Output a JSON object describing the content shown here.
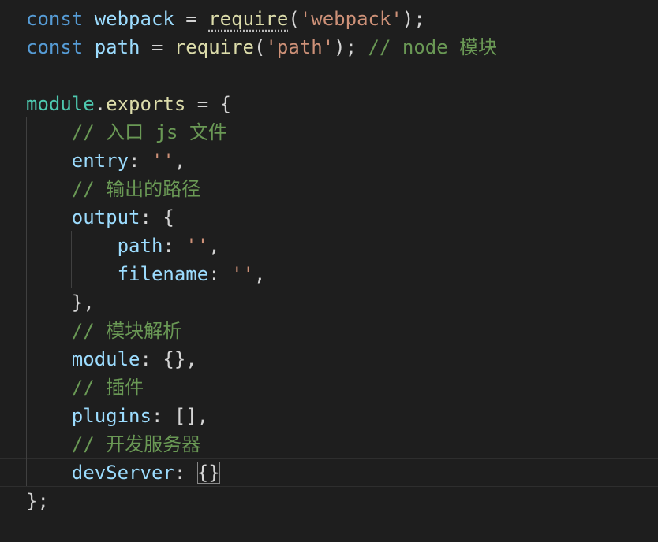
{
  "editor": {
    "colors": {
      "background": "#1e1e1e",
      "keyword": "#569cd6",
      "variable": "#9cdcfe",
      "function": "#dcdcaa",
      "string": "#ce9178",
      "comment": "#6a9955",
      "punctuation": "#d4d4d4"
    },
    "lines": [
      {
        "tokens": [
          [
            "kw",
            "const"
          ],
          [
            "pun",
            " "
          ],
          [
            "var",
            "webpack"
          ],
          [
            "pun",
            " = "
          ],
          [
            "fn",
            "require"
          ],
          [
            "pun",
            "("
          ],
          [
            "str",
            "'webpack'"
          ],
          [
            "pun",
            ");"
          ]
        ]
      },
      {
        "tokens": [
          [
            "kw",
            "const"
          ],
          [
            "pun",
            " "
          ],
          [
            "var",
            "path"
          ],
          [
            "pun",
            " = "
          ],
          [
            "fn",
            "require"
          ],
          [
            "pun",
            "("
          ],
          [
            "str",
            "'path'"
          ],
          [
            "pun",
            ");"
          ],
          [
            "pun",
            " "
          ],
          [
            "cmt",
            "// node 模块"
          ]
        ]
      },
      {
        "tokens": []
      },
      {
        "tokens": [
          [
            "obj",
            "module"
          ],
          [
            "pun",
            "."
          ],
          [
            "prop",
            "exports"
          ],
          [
            "pun",
            " = {"
          ]
        ]
      },
      {
        "tokens": [
          [
            "pun",
            "    "
          ],
          [
            "cmt",
            "// 入口 js 文件"
          ]
        ]
      },
      {
        "tokens": [
          [
            "pun",
            "    "
          ],
          [
            "key",
            "entry"
          ],
          [
            "pun",
            ": "
          ],
          [
            "str",
            "''"
          ],
          [
            "pun",
            ","
          ]
        ]
      },
      {
        "tokens": [
          [
            "pun",
            "    "
          ],
          [
            "cmt",
            "// 输出的路径"
          ]
        ]
      },
      {
        "tokens": [
          [
            "pun",
            "    "
          ],
          [
            "key",
            "output"
          ],
          [
            "pun",
            ": {"
          ]
        ]
      },
      {
        "tokens": [
          [
            "pun",
            "        "
          ],
          [
            "key",
            "path"
          ],
          [
            "pun",
            ": "
          ],
          [
            "str",
            "''"
          ],
          [
            "pun",
            ","
          ]
        ]
      },
      {
        "tokens": [
          [
            "pun",
            "        "
          ],
          [
            "key",
            "filename"
          ],
          [
            "pun",
            ": "
          ],
          [
            "str",
            "''"
          ],
          [
            "pun",
            ","
          ]
        ]
      },
      {
        "tokens": [
          [
            "pun",
            "    },"
          ]
        ]
      },
      {
        "tokens": [
          [
            "pun",
            "    "
          ],
          [
            "cmt",
            "// 模块解析"
          ]
        ]
      },
      {
        "tokens": [
          [
            "pun",
            "    "
          ],
          [
            "key",
            "module"
          ],
          [
            "pun",
            ": {},"
          ]
        ]
      },
      {
        "tokens": [
          [
            "pun",
            "    "
          ],
          [
            "cmt",
            "// 插件"
          ]
        ]
      },
      {
        "tokens": [
          [
            "pun",
            "    "
          ],
          [
            "key",
            "plugins"
          ],
          [
            "pun",
            ": [],"
          ]
        ]
      },
      {
        "tokens": [
          [
            "pun",
            "    "
          ],
          [
            "cmt",
            "// 开发服务器"
          ]
        ]
      },
      {
        "tokens": [
          [
            "pun",
            "    "
          ],
          [
            "key",
            "devServer"
          ],
          [
            "pun",
            ": "
          ],
          [
            "bm",
            "{}"
          ]
        ],
        "current": true
      },
      {
        "tokens": [
          [
            "pun",
            "};"
          ]
        ]
      }
    ]
  }
}
